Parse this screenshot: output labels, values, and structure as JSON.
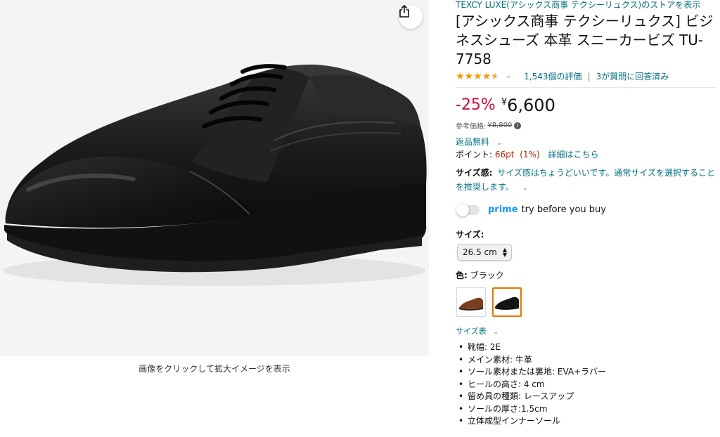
{
  "image": {
    "caption": "画像をクリックして拡大イメージを表示",
    "share_icon": "share-icon"
  },
  "store": {
    "link_text": "TEXCY LUXE(アシックス商事 テクシーリュクス)のストアを表示"
  },
  "product": {
    "title": "[アシックス商事 テクシーリュクス] ビジネスシューズ 本革 スニーカービズ TU-7758",
    "rating": 4.5,
    "rating_count_text": "1,543個の評価",
    "qa_text": "3が質問に回答済み"
  },
  "price": {
    "discount": "-25%",
    "currency": "¥",
    "value": "6,600",
    "ref_label": "参考価格:",
    "ref_value": "¥8,800"
  },
  "returns": {
    "label": "返品無料"
  },
  "points": {
    "label": "ポイント:",
    "value": "66pt",
    "percent": "(1%)",
    "detail_link": "詳細はこちら"
  },
  "fit": {
    "label": "サイズ感:",
    "text": "サイズ感はちょうどいいです。通常サイズを選択することを推奨します。"
  },
  "prime": {
    "word": "prime",
    "text": "try before you buy",
    "toggle_on": false
  },
  "size": {
    "label": "サイズ:",
    "selected": "26.5 cm"
  },
  "color": {
    "label": "色:",
    "selected": "ブラック",
    "swatches": [
      "brown",
      "black"
    ]
  },
  "size_chart": {
    "label": "サイズ表"
  },
  "features": [
    "靴幅: 2E",
    "メイン素材: 牛革",
    "ソール素材または裏地: EVA+ラバー",
    "ヒールの高さ: 4 cm",
    "留め具の種類: レースアップ",
    "ソールの厚さ:1.5cm",
    "立体成型インナーソール"
  ],
  "colors": {
    "link": "#007185",
    "discount": "#cc0c39",
    "star": "#ff9900",
    "prime": "#1399ff",
    "swatch_selected_border": "#e77600"
  }
}
